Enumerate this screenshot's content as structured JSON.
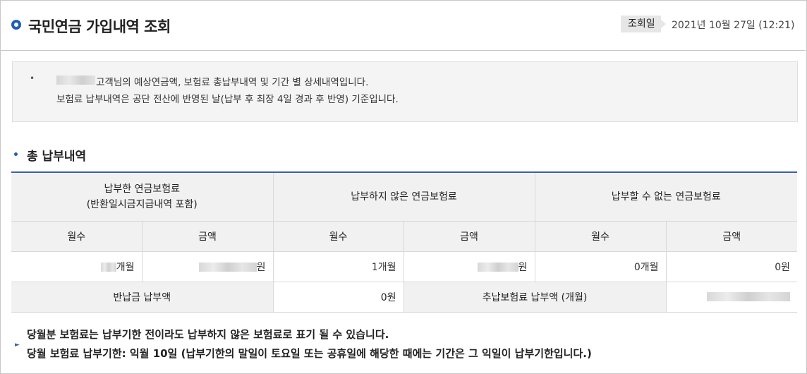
{
  "header": {
    "title": "국민연금 가입내역 조회",
    "date_label": "조회일",
    "date_value": "2021년 10월 27일 (12:21)"
  },
  "notice": {
    "line1": "고객님의 예상연금액, 보험료 총납부내역 및 기간 별 상세내역입니다.",
    "line2": "보험료 납부내역은 공단 전산에 반영된 날(납부 후 최장 4일 경과 후 반영) 기준입니다."
  },
  "section": {
    "title": "총 납부내역"
  },
  "table": {
    "group_headers": {
      "paid_line1": "납부한 연금보험료",
      "paid_line2": "(반환일시금지급내역 포함)",
      "unpaid": "납부하지 않은 연금보험료",
      "cannot_pay": "납부할 수 없는 연금보험료"
    },
    "sub_headers": {
      "months": "월수",
      "amount": "금액"
    },
    "row": {
      "paid_months_suffix": "개월",
      "paid_amount_suffix": "원",
      "unpaid_months": "1개월",
      "unpaid_amount_suffix": "원",
      "cannot_months": "0개월",
      "cannot_amount": "0원"
    },
    "bottom": {
      "refund_label": "반납금 납부액",
      "refund_value": "0원",
      "additional_label": "추납보험료 납부액 (개월)"
    }
  },
  "footer": {
    "line1": "당월분 보험료는 납부기한 전이라도 납부하지 않은 보험료로 표기 될 수 있습니다.",
    "line2": "당월 보험료 납부기한: 익월 10일 (납부기한의 말일이 토요일 또는 공휴일에 해당한 때에는 기간은 그 익일이 납부기한입니다.)"
  },
  "colors": {
    "accent": "#1f5fb4",
    "table_top_border": "#3a5fb0",
    "header_bg": "#f1f1f1",
    "notice_bg": "#f4f4f4"
  },
  "icons": {
    "title": "ring-bullet-icon",
    "section": "dot-bullet-icon",
    "footer": "caret-right-icon"
  }
}
